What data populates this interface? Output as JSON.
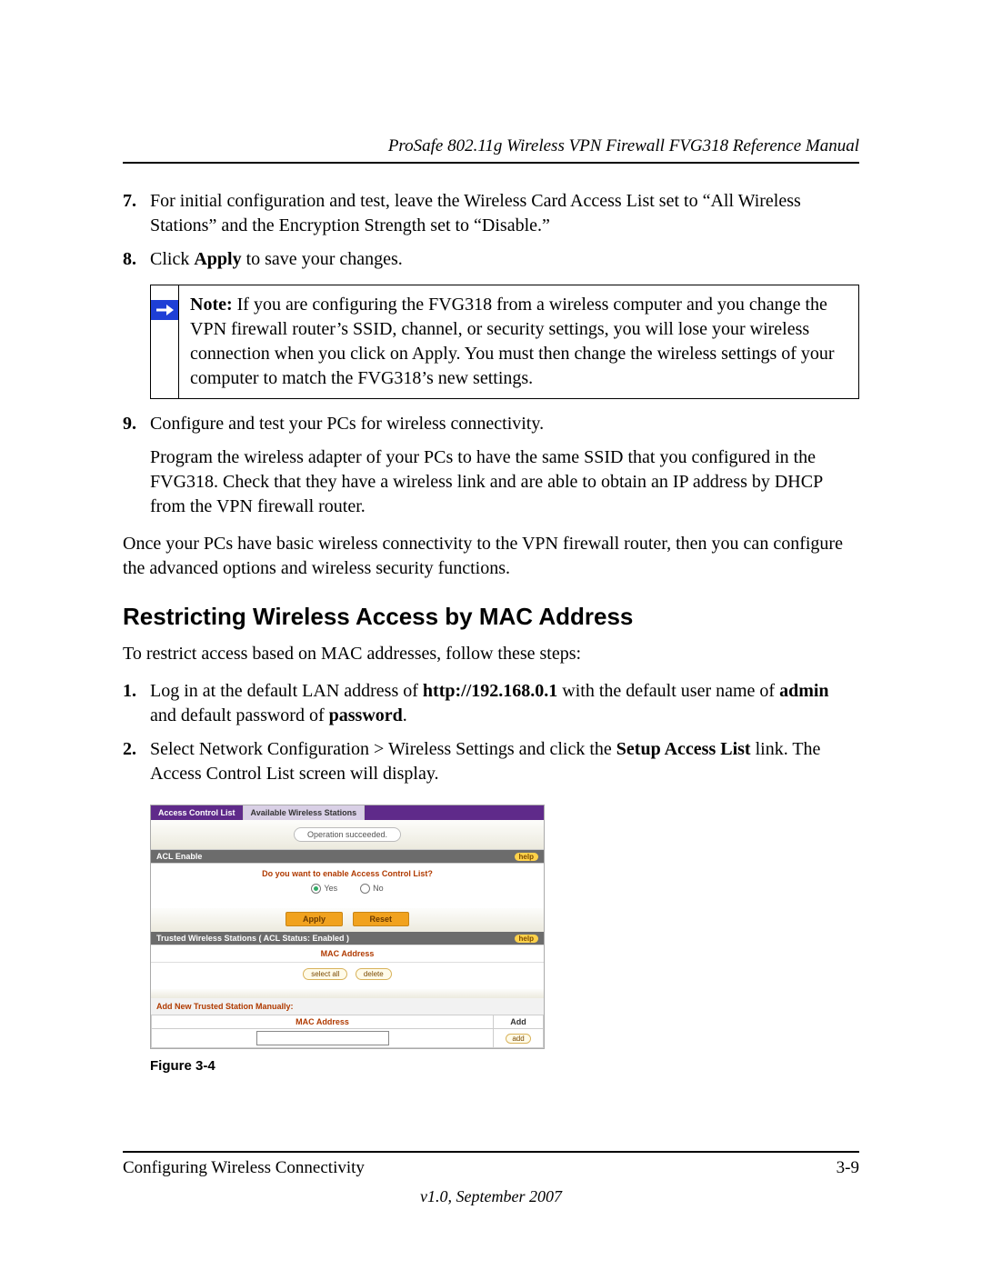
{
  "header": {
    "title": "ProSafe 802.11g Wireless VPN Firewall FVG318 Reference Manual"
  },
  "steps": {
    "s7": {
      "num": "7.",
      "text": "For initial configuration and test, leave the Wireless Card Access List set to “All Wireless Stations” and the Encryption Strength set to “Disable.”"
    },
    "s8": {
      "num": "8.",
      "pre": "Click ",
      "bold": "Apply",
      "post": " to save your changes."
    },
    "s9": {
      "num": "9.",
      "text": "Configure and test your PCs for wireless connectivity."
    },
    "s9_detail": "Program the wireless adapter of your PCs to have the same SSID that you configured in the FVG318. Check that they have a wireless link and are able to obtain an IP address by DHCP from the VPN firewall router."
  },
  "note": {
    "label": "Note:",
    "text": " If you are configuring the FVG318 from a wireless computer and you change the VPN firewall router’s SSID, channel, or security settings, you will lose your wireless connection when you click on Apply. You must then change the wireless settings of your computer to match the FVG318’s new settings."
  },
  "after_list": "Once your PCs have basic wireless connectivity to the VPN firewall router, then you can configure the advanced options and wireless security functions.",
  "section": {
    "heading": "Restricting Wireless Access by MAC Address",
    "intro": "To restrict access based on MAC addresses, follow these steps:",
    "s1": {
      "num": "1.",
      "t1": "Log in at the default LAN address of ",
      "b1": "http://192.168.0.1",
      "t2": " with the default user name of ",
      "b2": "admin",
      "t3": " and default password of ",
      "b3": "password",
      "t4": "."
    },
    "s2": {
      "num": "2.",
      "t1": "Select Network Configuration > Wireless Settings and click the ",
      "b1": "Setup Access List",
      "t2": " link. The Access Control List screen will display."
    }
  },
  "figure": {
    "caption": "Figure 3-4",
    "tabs": {
      "active": "Access Control List",
      "inactive": "Available Wireless Stations"
    },
    "op_msg": "Operation succeeded.",
    "panel1": {
      "title": "ACL Enable",
      "help": "help",
      "question": "Do you want to enable Access Control List?",
      "yes": "Yes",
      "no": "No",
      "apply": "Apply",
      "reset": "Reset"
    },
    "panel2": {
      "title": "Trusted Wireless Stations ( ACL Status: Enabled )",
      "help": "help",
      "mac": "MAC Address",
      "select_all": "select all",
      "delete": "delete"
    },
    "manual": {
      "title": "Add New Trusted Station Manually:",
      "mac": "MAC Address",
      "addcol": "Add",
      "add": "add"
    }
  },
  "footer": {
    "left": "Configuring Wireless Connectivity",
    "right": "3-9",
    "center": "v1.0, September 2007"
  }
}
